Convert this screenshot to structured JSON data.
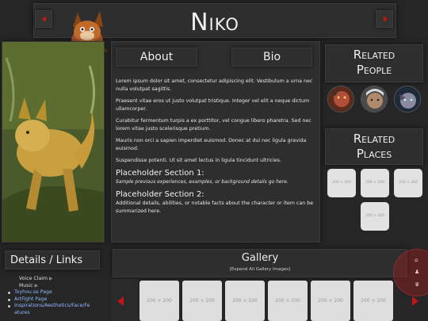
{
  "header": {
    "title": "Niko",
    "prev_icon": "triangle-left-icon",
    "next_icon": "triangle-right-icon"
  },
  "tabs": [
    {
      "label": "About"
    },
    {
      "label": "Bio"
    }
  ],
  "bio": {
    "paragraphs": [
      "Lorem ipsum dolor sit amet, consectetur adipiscing elit. Vestibulum a urna nec nulla volutpat sagittis.",
      "Praesent vitae eros ut justo volutpat tristique. Integer vel elit a neque dictum ullamcorper.",
      "Curabitur fermentum turpis a ex porttitor, vel congue libero pharetra. Sed nec lorem vitae justo scelerisque pretium.",
      "Mauris non orci a sapien imperdiet euismod. Donec at dui nec ligula gravida euismod.",
      "Suspendisse potenti. Ut sit amet lectus in ligula tincidunt ultricies."
    ],
    "section1_title": "Placeholder Section 1:",
    "section1_text": "Sample previous experiences, examples, or background details go here.",
    "section2_title": "Placeholder Section 2:",
    "section2_text": "Additional details, abilities, or notable facts about the character or item can be summarized here."
  },
  "related_people": {
    "title_line1": "Related",
    "title_line2": "People"
  },
  "related_places": {
    "title_line1": "Related",
    "title_line2": "Places",
    "thumbs": [
      "200 × 200",
      "200 × 200",
      "200 × 200",
      "200 × 200"
    ]
  },
  "details": {
    "title": "Details / Links",
    "voice_claim": "Voice Claim",
    "music": "Music",
    "links": [
      "Toyhou.se Page",
      "ArtFight Page",
      "Inspirations/Aesthetics/Face/Fe",
      "atures"
    ]
  },
  "gallery": {
    "title": "Gallery",
    "expand": "[Expand All Gallery Images]",
    "thumbs": [
      "200 × 200",
      "200 × 200",
      "200 × 200",
      "200 × 200",
      "200 × 200",
      "200 × 200"
    ]
  },
  "colors": {
    "accent": "#c21515",
    "background": "#262626",
    "panel": "#2e2e2e"
  }
}
